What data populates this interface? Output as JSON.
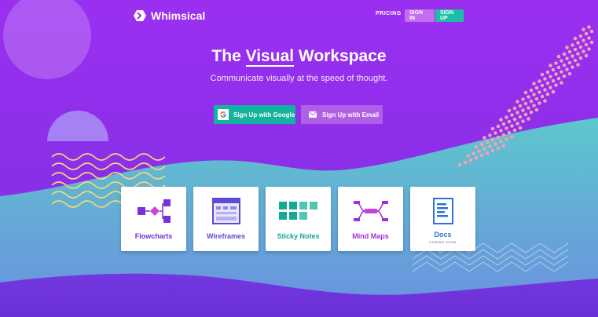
{
  "brand": {
    "name": "Whimsical"
  },
  "nav": {
    "pricing": "PRICING",
    "sign_in": "SIGN IN",
    "sign_up": "SIGN UP"
  },
  "hero": {
    "title_pre": "The ",
    "title_highlight": "Visual",
    "title_post": " Workspace",
    "subtitle": "Communicate visually at the speed of thought."
  },
  "cta": {
    "google": "Sign Up with Google",
    "email": "Sign Up with Email"
  },
  "cards": [
    {
      "label": "Flowcharts",
      "color": "#6b2fd9"
    },
    {
      "label": "Wireframes",
      "color": "#5b4bd6"
    },
    {
      "label": "Sticky Notes",
      "color": "#14a994"
    },
    {
      "label": "Mind Maps",
      "color": "#a02fd8"
    },
    {
      "label": "Docs",
      "sub": "COMING SOON",
      "color": "#2f6fd6"
    }
  ],
  "colors": {
    "purple_bg": "#9b2ff0",
    "teal": "#13b39f",
    "email_btn": "#b15fe6",
    "sign_in_btn": "#c56cf0",
    "sign_up_btn": "#1bbfa5"
  }
}
